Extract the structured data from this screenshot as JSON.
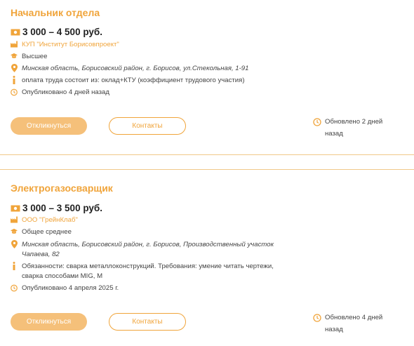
{
  "colors": {
    "accent": "#f0a43a",
    "button_fill": "#f5c07a",
    "divider": "#f0c889"
  },
  "vacancies": [
    {
      "title": "Начальник отдела",
      "salary": "3 000 – 4 500 руб.",
      "company": "КУП \"Институт Борисовпроект\"",
      "education": "Высшее",
      "address": "Минская область, Борисовский район, г. Борисов, ул.Стекольная, 1-91",
      "info": "оплата труда состоит из: оклад+КТУ (коэффициент трудового участия)",
      "published": "Опубликовано 4 дней назад",
      "apply_label": "Откликнуться",
      "contacts_label": "Контакты",
      "updated": "Обновлено 2 дней назад"
    },
    {
      "title": "Электрогазосварщик",
      "salary": "3 000 – 3 500 руб.",
      "company": "ООО \"ГрейнКлаб\"",
      "education": "Общее среднее",
      "address": "Минская область, Борисовский район, г. Борисов, Производственный участок Чапаева, 82",
      "info": "Обязанности: сварка металлоконструкций. Требования: умение читать чертежи, сварка способами MIG, M",
      "published": "Опубликовано 4 апреля 2025 г.",
      "apply_label": "Откликнуться",
      "contacts_label": "Контакты",
      "updated": "Обновлено 4 дней назад"
    }
  ],
  "icons": [
    "money-icon",
    "factory-icon",
    "graduation-cap-icon",
    "location-pin-icon",
    "info-icon",
    "clock-icon"
  ]
}
